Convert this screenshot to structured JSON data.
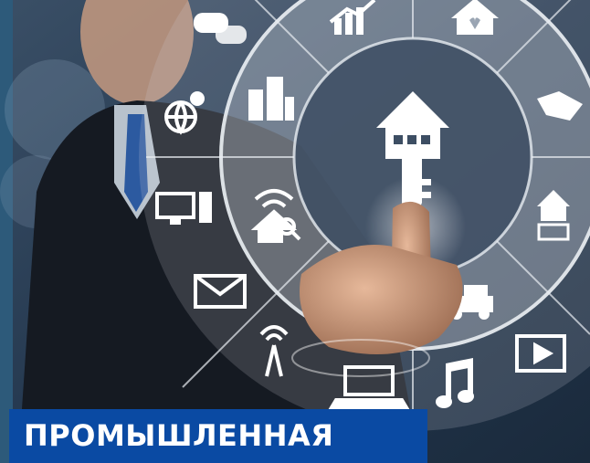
{
  "caption": {
    "text": "ПРОМЫШЛЕННАЯ"
  },
  "colors": {
    "caption_background": "#0a4aa3",
    "caption_text": "#ffffff",
    "background": "#1d3047",
    "wheel_tint": "#c9ced6"
  },
  "wheel": {
    "center_icon": "house-key-icon",
    "inner_ring_icons": [
      "city-buildings-icon",
      "wifi-search-house-icon",
      "family-icon",
      "car-icon",
      "house-cart-icon",
      "handshake-icon",
      "heart-house-icon",
      "chart-icon"
    ],
    "outer_ring_icons": [
      "chat-bubbles-icon",
      "globe-location-icon",
      "monitor-pc-icon",
      "envelope-icon",
      "radio-tower-icon",
      "laptop-icon",
      "music-note-icon",
      "video-player-icon"
    ]
  }
}
